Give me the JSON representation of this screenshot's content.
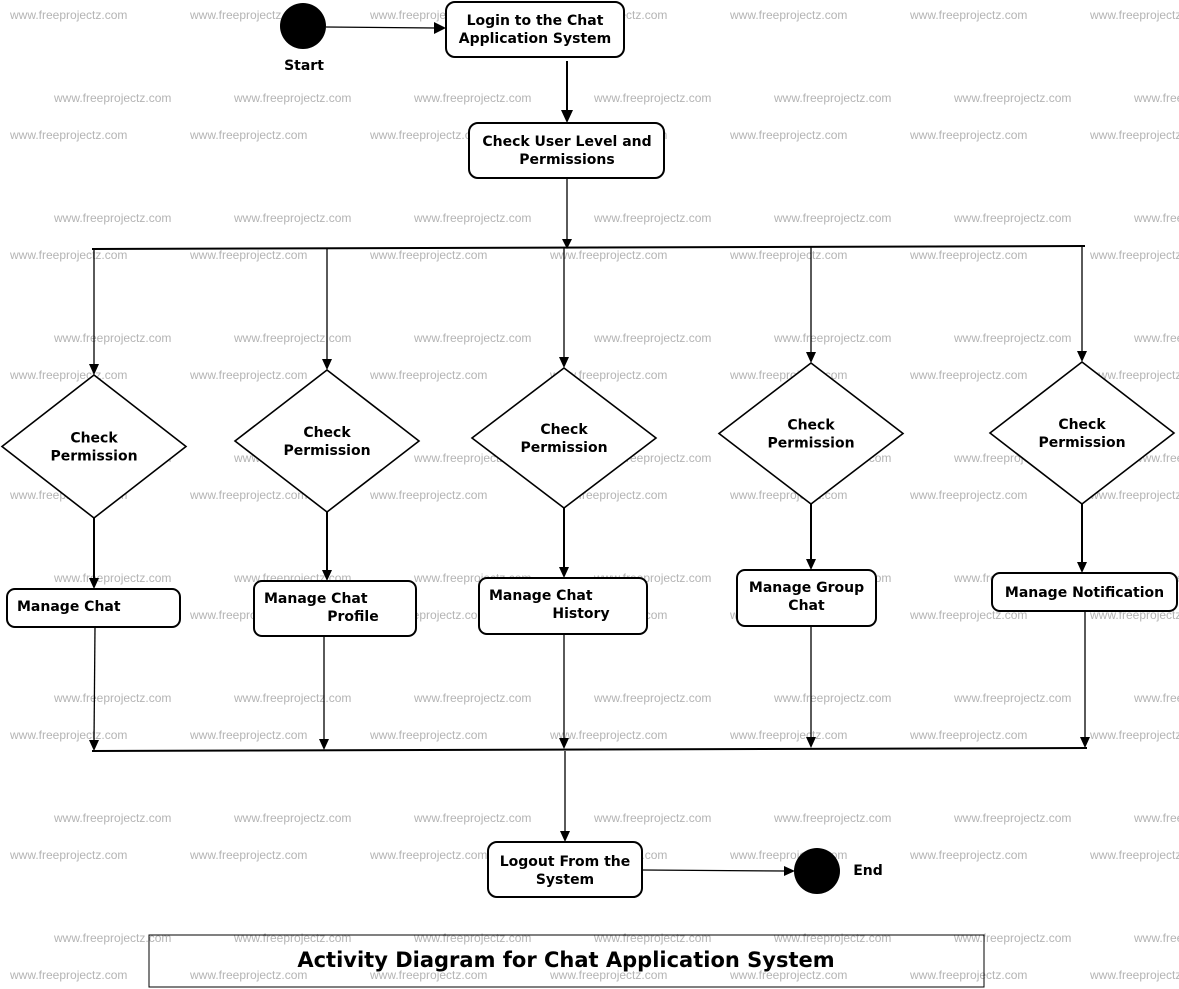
{
  "watermark": "www.freeprojectz.com",
  "diagram": {
    "title": "Activity Diagram for Chat Application System",
    "start": {
      "label": "Start"
    },
    "end": {
      "label": "End"
    },
    "login": {
      "lines": [
        "Login to the Chat",
        "Application System"
      ]
    },
    "check_user": {
      "lines": [
        "Check User Level and",
        "Permissions"
      ]
    },
    "branches": [
      {
        "decision": [
          "Check",
          "Permission"
        ],
        "activity": [
          "Manage Chat"
        ]
      },
      {
        "decision": [
          "Check",
          "Permission"
        ],
        "activity": [
          "Manage Chat",
          "Profile"
        ]
      },
      {
        "decision": [
          "Check",
          "Permission"
        ],
        "activity": [
          "Manage Chat",
          "History"
        ]
      },
      {
        "decision": [
          "Check",
          "Permission"
        ],
        "activity": [
          "Manage Group",
          "Chat"
        ]
      },
      {
        "decision": [
          "Check",
          "Permission"
        ],
        "activity": [
          "Manage Notification"
        ]
      }
    ],
    "logout": {
      "lines": [
        "Logout From the",
        "System"
      ]
    }
  },
  "colors": {
    "stroke": "#000000",
    "background": "#ffffff",
    "watermark": "#b4b4b4"
  }
}
